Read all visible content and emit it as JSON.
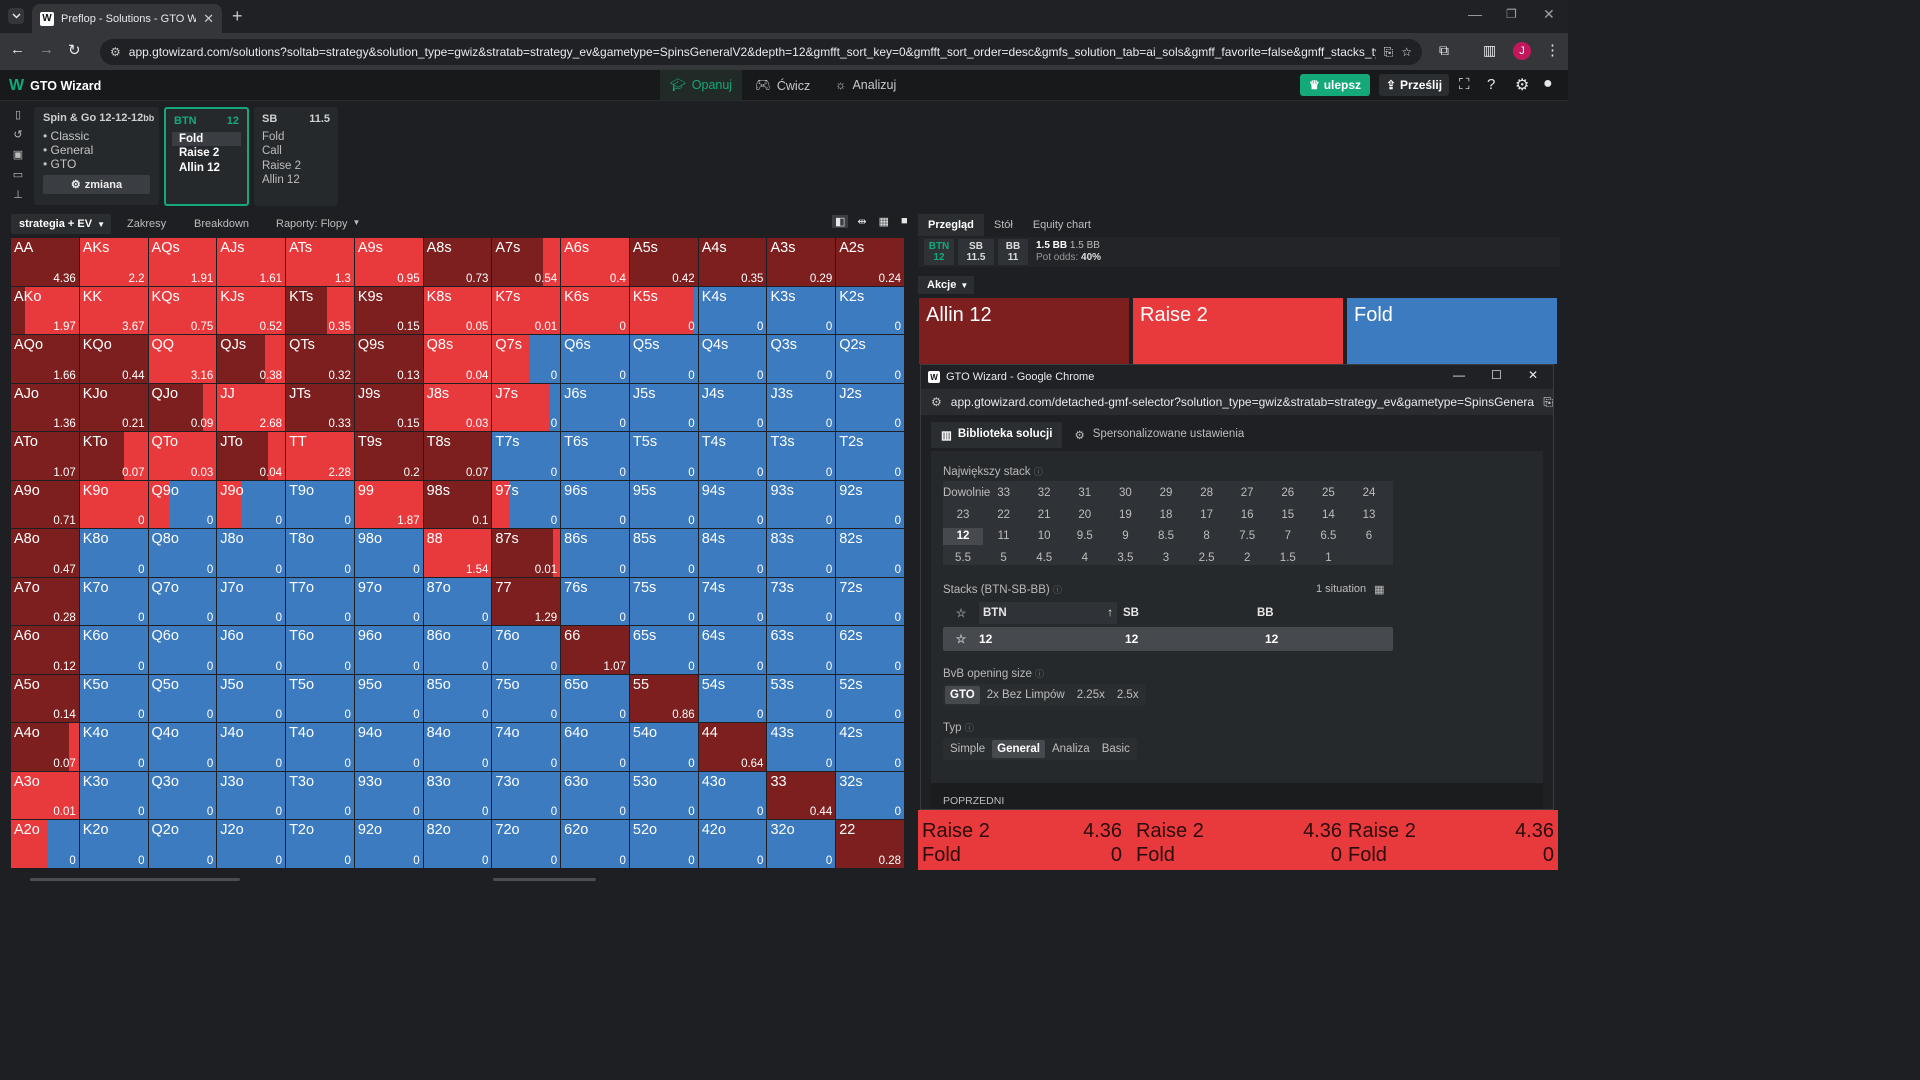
{
  "browser": {
    "tab_title": "Preflop - Solutions - GTO Wizard",
    "url": "app.gtowizard.com/solutions?soltab=strategy&solution_type=gwiz&stratab=strategy_ev&gametype=SpinsGeneralV2&depth=12&gmfft_sort_key=0&gmfft_sort_order=desc&gmfs_solution_tab=ai_sols&gmff_favorite=false&gmff_stacks_type=S...",
    "avatar_letter": "J"
  },
  "app": {
    "logo": "GTO Wizard",
    "nav": [
      "Opanuj",
      "Ćwicz",
      "Analizuj"
    ],
    "upgrade": "ulepsz",
    "upload": "Prześlij"
  },
  "game_card": {
    "title": "Spin & Go",
    "stacks": "12-12-12",
    "stacks_unit": "bb",
    "items": [
      "Classic",
      "General",
      "GTO"
    ],
    "change_btn": "zmiana"
  },
  "positions": [
    {
      "name": "BTN",
      "stack": "12",
      "actions": [
        "Fold",
        "Raise 2",
        "Allin 12"
      ],
      "active": true
    },
    {
      "name": "SB",
      "stack": "11.5",
      "actions": [
        "Fold",
        "Call",
        "Raise 2",
        "Allin 12"
      ],
      "active": false
    }
  ],
  "toolbar": {
    "strategy": "strategia + EV",
    "ranges": "Zakresy",
    "breakdown": "Breakdown",
    "reports": "Raporty: Flopy"
  },
  "grid": [
    [
      "AA|4.36|A",
      "AKs|2.2|R",
      "AQs|1.91|R",
      "AJs|1.61|R",
      "ATs|1.3|R",
      "A9s|0.95|R",
      "A8s|0.73|A",
      "A7s|0.54|A+R.25",
      "A6s|0.4|R",
      "A5s|0.42|A",
      "A4s|0.35|A",
      "A3s|0.29|A",
      "A2s|0.24|A"
    ],
    [
      "AKo|1.97|A+R.8",
      "KK|3.67|R",
      "KQs|0.75|R",
      "KJs|0.52|R",
      "KTs|0.35|A+R.4",
      "K9s|0.15|A",
      "K8s|0.05|R",
      "K7s|0.01|R",
      "K6s|0|R",
      "K5s|0|R+F.05",
      "K4s|0|F",
      "K3s|0|F",
      "K2s|0|F"
    ],
    [
      "AQo|1.66|A",
      "KQo|0.44|A",
      "QQ|3.16|R",
      "QJs|0.38|A+R.3",
      "QTs|0.32|A",
      "Q9s|0.13|A",
      "Q8s|0.04|R",
      "Q7s|0|R+F.45",
      "Q6s|0|F",
      "Q5s|0|F",
      "Q4s|0|F",
      "Q3s|0|F",
      "Q2s|0|F"
    ],
    [
      "AJo|1.36|A",
      "KJo|0.21|A",
      "QJo|0.09|A+R.2",
      "JJ|2.68|R",
      "JTs|0.33|A",
      "J9s|0.15|A",
      "J8s|0.03|R",
      "J7s|0|R+F.15",
      "J6s|0|F",
      "J5s|0|F",
      "J4s|0|F",
      "J3s|0|F",
      "J2s|0|F"
    ],
    [
      "ATo|1.07|A",
      "KTo|0.07|A+R.35",
      "QTo|0.03|R",
      "JTo|0.04|A+R.25",
      "TT|2.28|R",
      "T9s|0.2|A",
      "T8s|0.07|A",
      "T7s|0|F",
      "T6s|0|F",
      "T5s|0|F",
      "T4s|0|F",
      "T3s|0|F",
      "T2s|0|F"
    ],
    [
      "A9o|0.71|A",
      "K9o|0|R",
      "Q9o|0|R.3+F.7",
      "J9o|0|R.35+F.65",
      "T9o|0|F",
      "99|1.87|R",
      "98s|0.1|A",
      "97s|0|R.25+F.75",
      "96s|0|F",
      "95s|0|F",
      "94s|0|F",
      "93s|0|F",
      "92s|0|F"
    ],
    [
      "A8o|0.47|A",
      "K8o|0|F",
      "Q8o|0|F",
      "J8o|0|F",
      "T8o|0|F",
      "98o|0|F",
      "88|1.54|R",
      "87s|0.01|A+R.1",
      "86s|0|F",
      "85s|0|F",
      "84s|0|F",
      "83s|0|F",
      "82s|0|F"
    ],
    [
      "A7o|0.28|A",
      "K7o|0|F",
      "Q7o|0|F",
      "J7o|0|F",
      "T7o|0|F",
      "97o|0|F",
      "87o|0|F",
      "77|1.29|A",
      "76s|0|F",
      "75s|0|F",
      "74s|0|F",
      "73s|0|F",
      "72s|0|F"
    ],
    [
      "A6o|0.12|A",
      "K6o|0|F",
      "Q6o|0|F",
      "J6o|0|F",
      "T6o|0|F",
      "96o|0|F",
      "86o|0|F",
      "76o|0|F",
      "66|1.07|A",
      "65s|0|F",
      "64s|0|F",
      "63s|0|F",
      "62s|0|F"
    ],
    [
      "A5o|0.14|A",
      "K5o|0|F",
      "Q5o|0|F",
      "J5o|0|F",
      "T5o|0|F",
      "95o|0|F",
      "85o|0|F",
      "75o|0|F",
      "65o|0|F",
      "55|0.86|A",
      "54s|0|F",
      "53s|0|F",
      "52s|0|F"
    ],
    [
      "A4o|0.07|A+R.15",
      "K4o|0|F",
      "Q4o|0|F",
      "J4o|0|F",
      "T4o|0|F",
      "94o|0|F",
      "84o|0|F",
      "74o|0|F",
      "64o|0|F",
      "54o|0|F",
      "44|0.64|A",
      "43s|0|F",
      "42s|0|F"
    ],
    [
      "A3o|0.01|R",
      "K3o|0|F",
      "Q3o|0|F",
      "J3o|0|F",
      "T3o|0|F",
      "93o|0|F",
      "83o|0|F",
      "73o|0|F",
      "63o|0|F",
      "53o|0|F",
      "43o|0|F",
      "33|0.44|A",
      "32s|0|F"
    ],
    [
      "A2o|0|R.55+F.45",
      "K2o|0|F",
      "Q2o|0|F",
      "J2o|0|F",
      "T2o|0|F",
      "92o|0|F",
      "82o|0|F",
      "72o|0|F",
      "62o|0|F",
      "52o|0|F",
      "42o|0|F",
      "32o|0|F",
      "22|0.28|A"
    ]
  ],
  "colors": {
    "allin": "#7d1f1f",
    "raise": "#e8393c",
    "fold": "#3c7bbf",
    "accent": "#15a97a"
  },
  "right": {
    "tabs": [
      "Przegląd",
      "Stół",
      "Equity chart"
    ],
    "seats": [
      {
        "name": "BTN",
        "stack": "12"
      },
      {
        "name": "SB",
        "stack": "11.5"
      },
      {
        "name": "BB",
        "stack": "11"
      }
    ],
    "pot": "1.5 BB",
    "pot_secondary": "1.5 BB",
    "pot_odds_label": "Pot odds:",
    "pot_odds": "40%",
    "actions_dropdown": "Akcje",
    "big_actions": [
      "Allin 12",
      "Raise 2",
      "Fold"
    ],
    "bottom_rows": [
      {
        "label": "Raise 2",
        "value": "4.36"
      },
      {
        "label": "Fold",
        "value": "0"
      }
    ]
  },
  "popup": {
    "window_title": "GTO Wizard - Google Chrome",
    "url": "app.gtowizard.com/detached-gmf-selector?solution_type=gwiz&stratab=strategy_ev&gametype=SpinsGenera...",
    "tabs": [
      "Biblioteka solucji",
      "Spersonalizowane ustawienia"
    ],
    "largest_stack_label": "Największy stack",
    "largest_stack_options": [
      "Dowolnie",
      "33",
      "32",
      "31",
      "30",
      "29",
      "28",
      "27",
      "26",
      "25",
      "24",
      "23",
      "22",
      "21",
      "20",
      "19",
      "18",
      "17",
      "16",
      "15",
      "14",
      "13",
      "12",
      "11",
      "10",
      "9.5",
      "9",
      "8.5",
      "8",
      "7.5",
      "7",
      "6.5",
      "6",
      "5.5",
      "5",
      "4.5",
      "4",
      "3.5",
      "3",
      "2.5",
      "2",
      "1.5",
      "1"
    ],
    "largest_stack_selected": "12",
    "stacks_label": "Stacks (BTN-SB-BB)",
    "situations": "1 situation",
    "stack_cols": [
      "BTN",
      "SB",
      "BB"
    ],
    "stack_row": [
      "12",
      "12",
      "12"
    ],
    "bvb_label": "BvB opening size",
    "bvb_options": [
      "GTO",
      "2x Bez Limpów",
      "2.25x",
      "2.5x"
    ],
    "bvb_selected": "GTO",
    "type_label": "Typ",
    "type_options": [
      "Simple",
      "General",
      "Analiza",
      "Basic"
    ],
    "type_selected": "General",
    "prev": "POPRZEDNI"
  }
}
